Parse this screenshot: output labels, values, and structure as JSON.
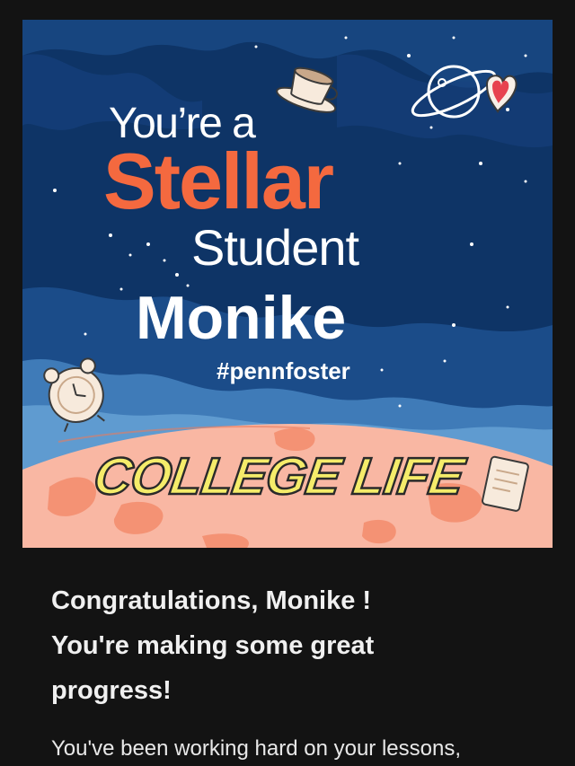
{
  "hero": {
    "line_youre": "You’re a",
    "line_stellar": "Stellar",
    "line_student": "Student",
    "line_name": "Monike",
    "hashtag": "#pennfoster",
    "banner": "COLLEGE LIFE",
    "colors": {
      "background": "#0e3466",
      "stellar": "#f4693f",
      "planet": "#f9b7a3",
      "banner_fill": "#f5ec6a"
    },
    "icons": [
      "planet-heart-icon",
      "coffee-cup-icon",
      "alarm-clock-icon",
      "paper-sticker-icon"
    ]
  },
  "message": {
    "heading_line1": "Congratulations, Monike !",
    "heading_line2": "You're making some great",
    "heading_line3": "progress!",
    "body_line1": "You've been working hard on your lessons,"
  }
}
